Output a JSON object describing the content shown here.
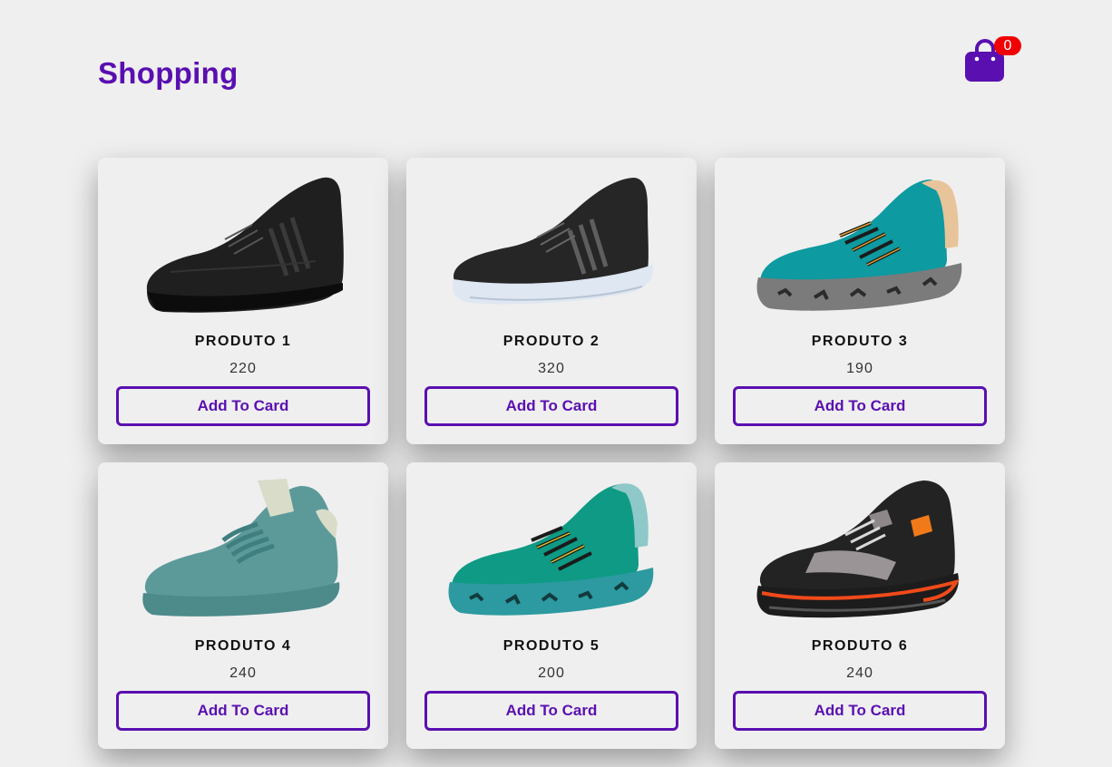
{
  "header": {
    "title": "Shopping",
    "cart": {
      "icon": "shopping-bag-icon",
      "count": "0"
    }
  },
  "colors": {
    "accent": "#5a0fb0",
    "badge": "#f00000",
    "background": "#efefef"
  },
  "products": [
    {
      "name": "PRODUTO 1",
      "price": "220",
      "button": "Add To Card",
      "image": "black-sneaker-image"
    },
    {
      "name": "PRODUTO 2",
      "price": "320",
      "button": "Add To Card",
      "image": "black-running-shoe-image"
    },
    {
      "name": "PRODUTO 3",
      "price": "190",
      "button": "Add To Card",
      "image": "teal-knit-sneaker-image"
    },
    {
      "name": "PRODUTO 4",
      "price": "240",
      "button": "Add To Card",
      "image": "sage-sneaker-image"
    },
    {
      "name": "PRODUTO 5",
      "price": "200",
      "button": "Add To Card",
      "image": "green-knit-sneaker-image"
    },
    {
      "name": "PRODUTO 6",
      "price": "240",
      "button": "Add To Card",
      "image": "black-orange-chunky-sneaker-image"
    }
  ]
}
